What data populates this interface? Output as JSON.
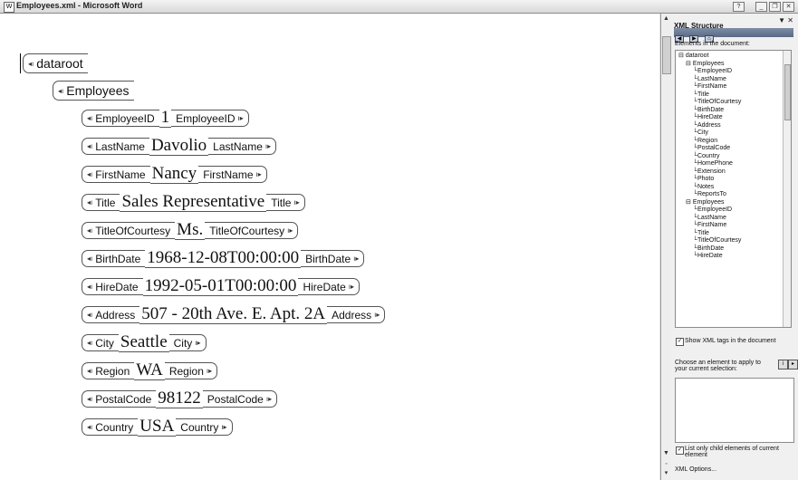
{
  "window": {
    "title": "Employees.xml - Microsoft Word",
    "app_icon": "word-icon"
  },
  "document": {
    "root": "dataroot",
    "group": "Employees",
    "fields": [
      {
        "name": "EmployeeID",
        "value": "1"
      },
      {
        "name": "LastName",
        "value": "Davolio"
      },
      {
        "name": "FirstName",
        "value": "Nancy"
      },
      {
        "name": "Title",
        "value": "Sales Representative"
      },
      {
        "name": "TitleOfCourtesy",
        "value": "Ms."
      },
      {
        "name": "BirthDate",
        "value": "1968-12-08T00:00:00"
      },
      {
        "name": "HireDate",
        "value": "1992-05-01T00:00:00"
      },
      {
        "name": "Address",
        "value": "507 - 20th Ave. E. Apt. 2A"
      },
      {
        "name": "City",
        "value": "Seattle"
      },
      {
        "name": "Region",
        "value": "WA"
      },
      {
        "name": "PostalCode",
        "value": "98122"
      },
      {
        "name": "Country",
        "value": "USA"
      }
    ]
  },
  "panel": {
    "title": "XML Structure",
    "elements_label": "Elements in the document:",
    "tree": [
      {
        "text": "dataroot",
        "level": 0,
        "expander": "⊟"
      },
      {
        "text": "Employees",
        "level": 1,
        "expander": "⊟"
      },
      {
        "text": "EmployeeID",
        "level": 2
      },
      {
        "text": "LastName",
        "level": 2
      },
      {
        "text": "FirstName",
        "level": 2
      },
      {
        "text": "Title",
        "level": 2
      },
      {
        "text": "TitleOfCourtesy",
        "level": 2
      },
      {
        "text": "BirthDate",
        "level": 2
      },
      {
        "text": "HireDate",
        "level": 2
      },
      {
        "text": "Address",
        "level": 2
      },
      {
        "text": "City",
        "level": 2
      },
      {
        "text": "Region",
        "level": 2
      },
      {
        "text": "PostalCode",
        "level": 2
      },
      {
        "text": "Country",
        "level": 2
      },
      {
        "text": "HomePhone",
        "level": 2
      },
      {
        "text": "Extension",
        "level": 2
      },
      {
        "text": "Photo",
        "level": 2
      },
      {
        "text": "Notes",
        "level": 2
      },
      {
        "text": "ReportsTo",
        "level": 2
      },
      {
        "text": "Employees",
        "level": 1,
        "expander": "⊟"
      },
      {
        "text": "EmployeeID",
        "level": 2
      },
      {
        "text": "LastName",
        "level": 2
      },
      {
        "text": "FirstName",
        "level": 2
      },
      {
        "text": "Title",
        "level": 2
      },
      {
        "text": "TitleOfCourtesy",
        "level": 2
      },
      {
        "text": "BirthDate",
        "level": 2
      },
      {
        "text": "HireDate",
        "level": 2
      }
    ],
    "show_tags_label": "Show XML tags in the document",
    "show_tags_checked": true,
    "choose_label": "Choose an element to apply to your current selection:",
    "list_children_label": "List only child elements of current element",
    "list_children_checked": true,
    "options_link": "XML Options..."
  }
}
